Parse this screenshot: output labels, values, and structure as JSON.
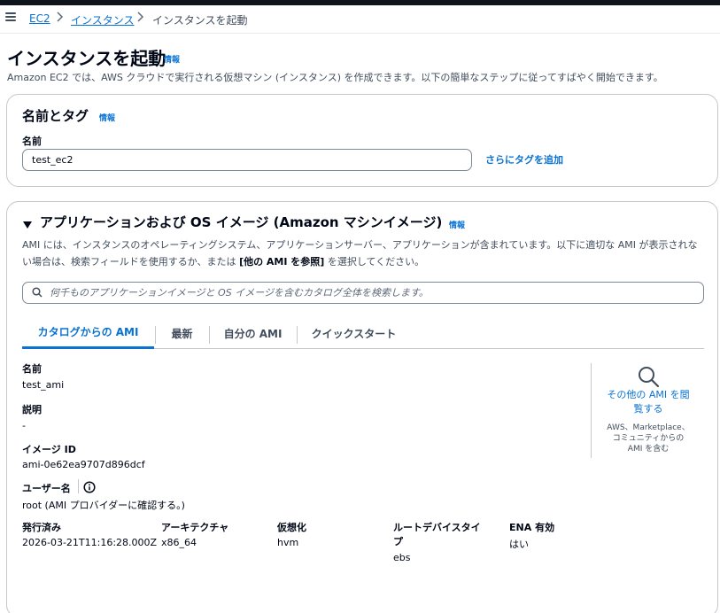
{
  "breadcrumb": {
    "items": [
      "EC2",
      "インスタンス"
    ],
    "current": "インスタンスを起動"
  },
  "page": {
    "title": "インスタンスを起動",
    "info": "情報",
    "description": "Amazon EC2 では、AWS クラウドで実行される仮想マシン (インスタンス) を作成できます。以下の簡単なステップに従ってすばやく開始できます。"
  },
  "name_tags": {
    "heading": "名前とタグ",
    "info": "情報",
    "name_label": "名前",
    "name_value": "test_ec2",
    "add_tags": "さらにタグを追加"
  },
  "ami": {
    "heading": "アプリケーションおよび OS イメージ (Amazon マシンイメージ)",
    "info": "情報",
    "description_pre": "AMI には、インスタンスのオペレーティングシステム、アプリケーションサーバー、アプリケーションが含まれています。以下に適切な AMI が表示されない場合は、検索フィールドを使用するか、または ",
    "description_bold": "[他の AMI を参照]",
    "description_post": " を選択してください。",
    "search_placeholder": "何千ものアプリケーションイメージと OS イメージを含むカタログ全体を検索します。",
    "tabs": [
      "カタログからの AMI",
      "最新",
      "自分の AMI",
      "クイックスタート"
    ],
    "active_tab": "カタログからの AMI",
    "details": {
      "name_label": "名前",
      "name_value": "test_ami",
      "desc_label": "説明",
      "desc_value": "-",
      "image_id_label": "イメージ ID",
      "image_id_value": "ami-0e62ea9707d896dcf",
      "username_label": "ユーザー名",
      "username_value": "root (AMI プロバイダーに確認する。)"
    },
    "meta": {
      "published_label": "発行済み",
      "published_value": "2026-03-21T11:16:28.000Z",
      "arch_label": "アーキテクチャ",
      "arch_value": "x86_64",
      "virt_label": "仮想化",
      "virt_value": "hvm",
      "root_label_1": "ルートデバイスタイ",
      "root_label_2": "プ",
      "root_value": "ebs",
      "ena_label": "ENA 有効",
      "ena_value": "はい"
    },
    "browse": {
      "link_1": "その他の AMI を閲",
      "link_2": "覧する",
      "note_1": "AWS、Marketplace、",
      "note_2": "コミュニティからの",
      "note_3": "AMI を含む"
    }
  },
  "icons": {
    "menu": "menu-icon",
    "breadcrumb_separator": "chevron-right-icon",
    "expand": "caret-down-icon",
    "search": "search-icon",
    "magnifier": "magnifier-icon",
    "info": "info-circle-icon"
  },
  "colors": {
    "link": "#0972d3",
    "text": "#000716",
    "secondary_text": "#414d5c",
    "border": "#c6c6cd",
    "topbar": "#0f141a"
  }
}
